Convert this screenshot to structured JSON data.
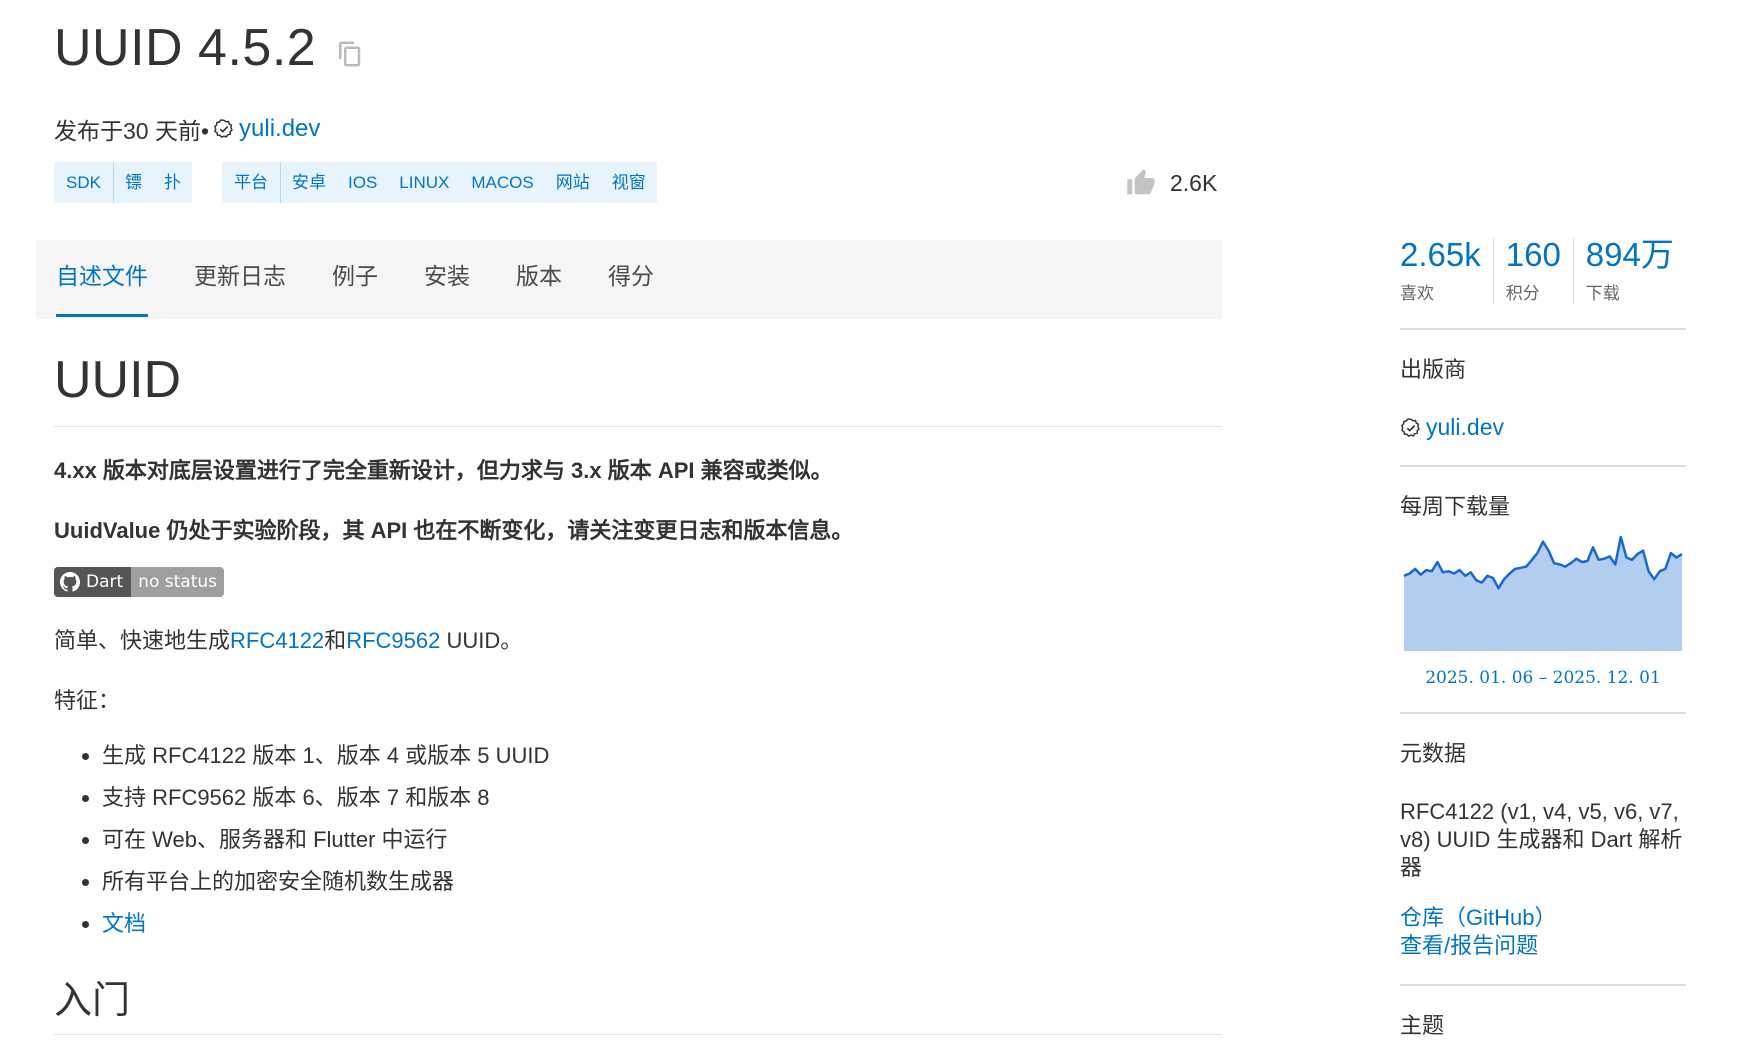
{
  "header": {
    "title": "UUID 4.5.2",
    "published_prefix": "发布于30 天前•",
    "publisher": "yuli.dev",
    "likes": "2.6K"
  },
  "tags": {
    "sdk": [
      "SDK",
      "镖",
      "扑"
    ],
    "platform": [
      "平台",
      "安卓",
      "IOS",
      "LINUX",
      "MACOS",
      "网站",
      "视窗"
    ]
  },
  "tabs": [
    "自述文件",
    "更新日志",
    "例子",
    "安装",
    "版本",
    "得分"
  ],
  "readme": {
    "h1": "UUID",
    "p1": "4.xx 版本对底层设置进行了完全重新设计，但力求与 3.x 版本 API 兼容或类似。",
    "p2": "UuidValue 仍处于实验阶段，其 API 也在不断变化，请关注变更日志和版本信息。",
    "badge_left": "Dart",
    "badge_right": "no status",
    "intro_prefix": "简单、快速地生成",
    "rfc4122": "RFC4122",
    "intro_and": "和",
    "rfc9562": "RFC9562",
    "intro_suffix": " UUID。",
    "features_label": "特征：",
    "features": [
      "生成 RFC4122 版本 1、版本 4 或版本 5 UUID",
      "支持 RFC9562 版本 6、版本 7 和版本 8",
      "可在 Web、服务器和 Flutter 中运行",
      "所有平台上的加密安全随机数生成器"
    ],
    "docs_link": "文档",
    "h2": "入门"
  },
  "sidebar": {
    "stats": [
      {
        "value": "2.65k",
        "label": "喜欢"
      },
      {
        "value": "160",
        "label": "积分"
      },
      {
        "value": "894万",
        "label": "下载"
      }
    ],
    "publisher_title": "出版商",
    "publisher": "yuli.dev",
    "weekly_title": "每周下载量",
    "chart_caption": "2025. 01. 06 – 2025. 12. 01",
    "metadata_title": "元数据",
    "metadata_desc": "RFC4122 (v1, v4, v5, v6, v7, v8) UUID 生成器和 Dart 解析器",
    "repo_link": "仓库（GitHub）",
    "issues_link": "查看/报告问题",
    "topics_title": "主题"
  },
  "colors": {
    "accent": "#0175c2",
    "tag_bg": "#e7f4fd",
    "chart_fill": "#b3cdf0",
    "chart_line": "#1967d2"
  },
  "chart_data": {
    "type": "area",
    "title": "每周下载量",
    "x_range_label": "2025. 01. 06 – 2025. 12. 01",
    "values": [
      66,
      68,
      72,
      67,
      71,
      70,
      78,
      69,
      70,
      68,
      71,
      66,
      69,
      62,
      60,
      66,
      64,
      55,
      63,
      68,
      72,
      73,
      74,
      80,
      86,
      96,
      88,
      77,
      76,
      74,
      77,
      81,
      78,
      79,
      91,
      80,
      81,
      83,
      76,
      100,
      82,
      80,
      85,
      88,
      70,
      63,
      70,
      72,
      86,
      82,
      85
    ]
  }
}
